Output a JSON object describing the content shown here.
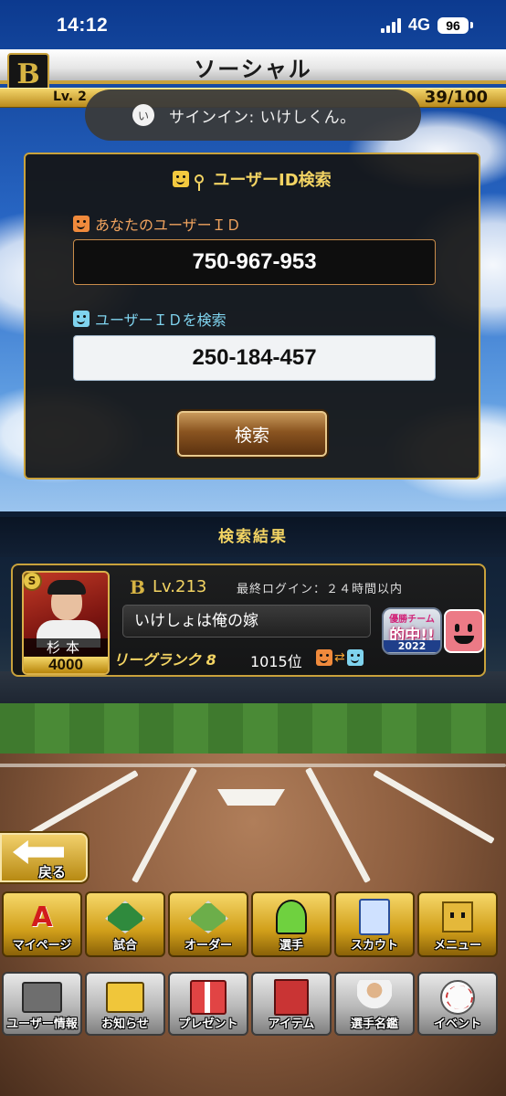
{
  "status_bar": {
    "time": "14:12",
    "network": "4G",
    "battery": "96"
  },
  "header": {
    "title": "ソーシャル",
    "logo_letter": "B",
    "level_prefix": "Lv. 2",
    "stamina": "39/100"
  },
  "toast": {
    "avatar_char": "い",
    "text": "サインイン: いけしくん。"
  },
  "search_panel": {
    "title": "ユーザーID検索",
    "my_id_label": "あなたのユーザーＩＤ",
    "my_id_value": "750-967-953",
    "search_id_label": "ユーザーＩＤを検索",
    "search_id_value": "250-184-457",
    "search_button": "検索"
  },
  "results": {
    "header": "検索結果",
    "card": {
      "player_rarity": "S",
      "player_name": "杉本",
      "player_value": "4000",
      "team_logo": "B",
      "level": "Lv.213",
      "last_login": "最終ログイン：２４時間以内",
      "message": "いけしょは俺の嫁",
      "league_rank": "リーグランク 8",
      "rank_position": "1015位",
      "badge_line1": "優勝チーム",
      "badge_line2": "的中!!",
      "badge_line3": "2022"
    }
  },
  "nav": {
    "back": "戻る",
    "main_menu": [
      {
        "label": "マイページ",
        "icon": "a-icon"
      },
      {
        "label": "試合",
        "icon": "stadium-icon"
      },
      {
        "label": "オーダー",
        "icon": "order-icon"
      },
      {
        "label": "選手",
        "icon": "player-icon"
      },
      {
        "label": "スカウト",
        "icon": "scout-card-icon"
      },
      {
        "label": "メニュー",
        "icon": "menu-box-icon"
      }
    ],
    "sub_menu": [
      {
        "label": "ユーザー情報",
        "icon": "user-info-icon"
      },
      {
        "label": "お知らせ",
        "icon": "notice-icon"
      },
      {
        "label": "プレゼント",
        "icon": "gift-icon"
      },
      {
        "label": "アイテム",
        "icon": "item-book-icon"
      },
      {
        "label": "選手名鑑",
        "icon": "player-directory-icon"
      },
      {
        "label": "イベント",
        "icon": "event-ball-icon"
      }
    ]
  },
  "colors": {
    "gold": "#c9a23c",
    "title_gold": "#f3d463",
    "panel_bg": "#141414"
  }
}
